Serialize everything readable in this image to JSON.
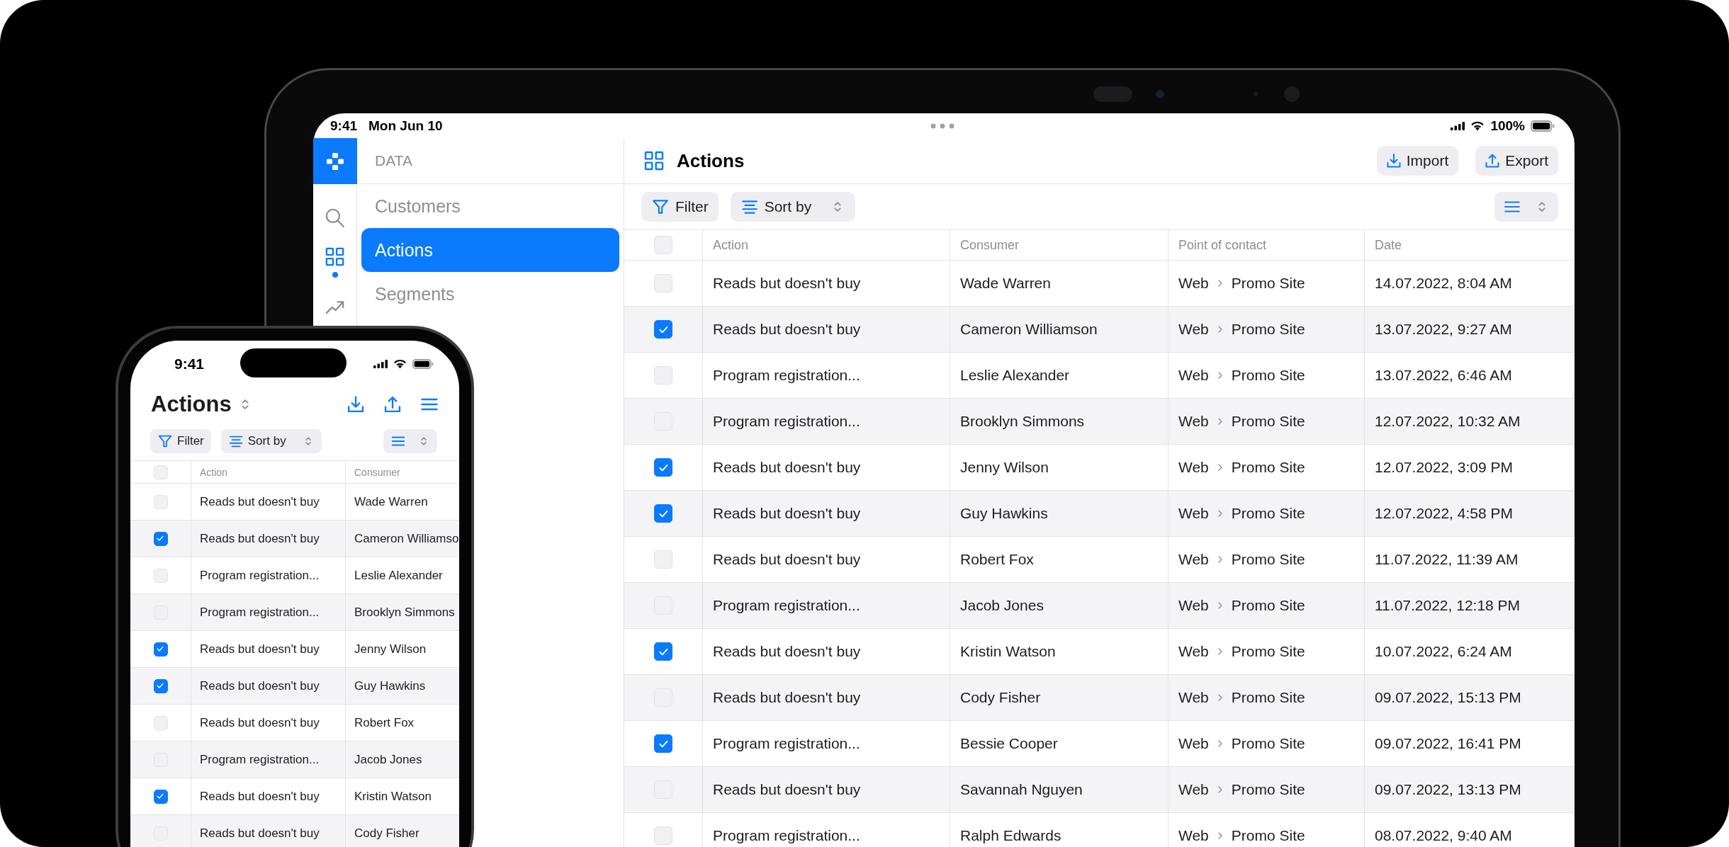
{
  "tablet": {
    "status_bar": {
      "time": "9:41",
      "date": "Mon Jun 10",
      "battery": "100%"
    },
    "rail": [
      {
        "kind": "search",
        "selected": false
      },
      {
        "kind": "grid",
        "selected": true
      },
      {
        "kind": "trend",
        "selected": false
      }
    ],
    "nav": {
      "section": "DATA",
      "items": [
        {
          "label": "Customers",
          "selected": false
        },
        {
          "label": "Actions",
          "selected": true
        },
        {
          "label": "Segments",
          "selected": false
        }
      ]
    },
    "header": {
      "title": "Actions",
      "buttons": [
        {
          "kind": "import",
          "label": "Import"
        },
        {
          "kind": "export",
          "label": "Export"
        }
      ]
    },
    "toolbar": {
      "filter": "Filter",
      "sort": "Sort by"
    },
    "table": {
      "all_checked": false,
      "columns": [
        "Action",
        "Consumer",
        "Point of contact",
        "Date"
      ],
      "rows": [
        {
          "checked": false,
          "action": "Reads but doesn't buy",
          "consumer": "Wade Warren",
          "channel": "Web",
          "target": "Promo Site",
          "date": "14.07.2022, 8:04 AM"
        },
        {
          "checked": true,
          "action": "Reads but doesn't buy",
          "consumer": "Cameron Williamson",
          "channel": "Web",
          "target": "Promo Site",
          "date": "13.07.2022, 9:27 AM"
        },
        {
          "checked": false,
          "action": "Program registration...",
          "consumer": "Leslie Alexander",
          "channel": "Web",
          "target": "Promo Site",
          "date": "13.07.2022, 6:46 AM"
        },
        {
          "checked": false,
          "action": "Program registration...",
          "consumer": "Brooklyn Simmons",
          "channel": "Web",
          "target": "Promo Site",
          "date": "12.07.2022, 10:32 AM"
        },
        {
          "checked": true,
          "action": "Reads but doesn't buy",
          "consumer": "Jenny Wilson",
          "channel": "Web",
          "target": "Promo Site",
          "date": "12.07.2022, 3:09 PM"
        },
        {
          "checked": true,
          "action": "Reads but doesn't buy",
          "consumer": "Guy Hawkins",
          "channel": "Web",
          "target": "Promo Site",
          "date": "12.07.2022, 4:58 PM"
        },
        {
          "checked": false,
          "action": "Reads but doesn't buy",
          "consumer": "Robert Fox",
          "channel": "Web",
          "target": "Promo Site",
          "date": "11.07.2022, 11:39 AM"
        },
        {
          "checked": false,
          "action": "Program registration...",
          "consumer": "Jacob Jones",
          "channel": "Web",
          "target": "Promo Site",
          "date": "11.07.2022, 12:18 PM"
        },
        {
          "checked": true,
          "action": "Reads but doesn't buy",
          "consumer": "Kristin Watson",
          "channel": "Web",
          "target": "Promo Site",
          "date": "10.07.2022, 6:24 AM"
        },
        {
          "checked": false,
          "action": "Reads but doesn't buy",
          "consumer": "Cody Fisher",
          "channel": "Web",
          "target": "Promo Site",
          "date": "09.07.2022, 15:13 PM"
        },
        {
          "checked": true,
          "action": "Program registration...",
          "consumer": "Bessie Cooper",
          "channel": "Web",
          "target": "Promo Site",
          "date": "09.07.2022, 16:41 PM"
        },
        {
          "checked": false,
          "action": "Reads but doesn't buy",
          "consumer": "Savannah Nguyen",
          "channel": "Web",
          "target": "Promo Site",
          "date": "09.07.2022, 13:13 PM"
        },
        {
          "checked": false,
          "action": "Program registration...",
          "consumer": "Ralph Edwards",
          "channel": "Web",
          "target": "Promo Site",
          "date": "08.07.2022, 9:40 AM"
        }
      ]
    }
  },
  "phone": {
    "status_bar": {
      "time": "9:41"
    },
    "title": "Actions",
    "toolbar": {
      "filter": "Filter",
      "sort": "Sort by"
    },
    "table": {
      "all_checked": false,
      "columns": [
        "Action",
        "Consumer"
      ],
      "rows": [
        {
          "checked": false,
          "action": "Reads but doesn't buy",
          "consumer": "Wade Warren"
        },
        {
          "checked": true,
          "action": "Reads but doesn't buy",
          "consumer": "Cameron Williamso"
        },
        {
          "checked": false,
          "action": "Program registration...",
          "consumer": "Leslie Alexander"
        },
        {
          "checked": false,
          "action": "Program registration...",
          "consumer": "Brooklyn Simmons"
        },
        {
          "checked": true,
          "action": "Reads but doesn't buy",
          "consumer": "Jenny Wilson"
        },
        {
          "checked": true,
          "action": "Reads but doesn't buy",
          "consumer": "Guy Hawkins"
        },
        {
          "checked": false,
          "action": "Reads but doesn't buy",
          "consumer": "Robert Fox"
        },
        {
          "checked": false,
          "action": "Program registration...",
          "consumer": "Jacob Jones"
        },
        {
          "checked": true,
          "action": "Reads but doesn't buy",
          "consumer": "Kristin Watson"
        },
        {
          "checked": false,
          "action": "Reads but doesn't buy",
          "consumer": "Cody Fisher"
        }
      ]
    }
  }
}
